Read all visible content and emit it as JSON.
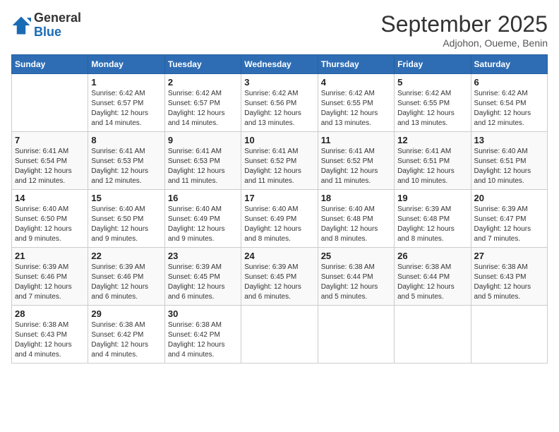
{
  "logo": {
    "line1": "General",
    "line2": "Blue"
  },
  "title": "September 2025",
  "subtitle": "Adjohon, Oueme, Benin",
  "days_header": [
    "Sunday",
    "Monday",
    "Tuesday",
    "Wednesday",
    "Thursday",
    "Friday",
    "Saturday"
  ],
  "weeks": [
    [
      {
        "num": "",
        "info": ""
      },
      {
        "num": "1",
        "info": "Sunrise: 6:42 AM\nSunset: 6:57 PM\nDaylight: 12 hours\nand 14 minutes."
      },
      {
        "num": "2",
        "info": "Sunrise: 6:42 AM\nSunset: 6:57 PM\nDaylight: 12 hours\nand 14 minutes."
      },
      {
        "num": "3",
        "info": "Sunrise: 6:42 AM\nSunset: 6:56 PM\nDaylight: 12 hours\nand 13 minutes."
      },
      {
        "num": "4",
        "info": "Sunrise: 6:42 AM\nSunset: 6:55 PM\nDaylight: 12 hours\nand 13 minutes."
      },
      {
        "num": "5",
        "info": "Sunrise: 6:42 AM\nSunset: 6:55 PM\nDaylight: 12 hours\nand 13 minutes."
      },
      {
        "num": "6",
        "info": "Sunrise: 6:42 AM\nSunset: 6:54 PM\nDaylight: 12 hours\nand 12 minutes."
      }
    ],
    [
      {
        "num": "7",
        "info": "Sunrise: 6:41 AM\nSunset: 6:54 PM\nDaylight: 12 hours\nand 12 minutes."
      },
      {
        "num": "8",
        "info": "Sunrise: 6:41 AM\nSunset: 6:53 PM\nDaylight: 12 hours\nand 12 minutes."
      },
      {
        "num": "9",
        "info": "Sunrise: 6:41 AM\nSunset: 6:53 PM\nDaylight: 12 hours\nand 11 minutes."
      },
      {
        "num": "10",
        "info": "Sunrise: 6:41 AM\nSunset: 6:52 PM\nDaylight: 12 hours\nand 11 minutes."
      },
      {
        "num": "11",
        "info": "Sunrise: 6:41 AM\nSunset: 6:52 PM\nDaylight: 12 hours\nand 11 minutes."
      },
      {
        "num": "12",
        "info": "Sunrise: 6:41 AM\nSunset: 6:51 PM\nDaylight: 12 hours\nand 10 minutes."
      },
      {
        "num": "13",
        "info": "Sunrise: 6:40 AM\nSunset: 6:51 PM\nDaylight: 12 hours\nand 10 minutes."
      }
    ],
    [
      {
        "num": "14",
        "info": "Sunrise: 6:40 AM\nSunset: 6:50 PM\nDaylight: 12 hours\nand 9 minutes."
      },
      {
        "num": "15",
        "info": "Sunrise: 6:40 AM\nSunset: 6:50 PM\nDaylight: 12 hours\nand 9 minutes."
      },
      {
        "num": "16",
        "info": "Sunrise: 6:40 AM\nSunset: 6:49 PM\nDaylight: 12 hours\nand 9 minutes."
      },
      {
        "num": "17",
        "info": "Sunrise: 6:40 AM\nSunset: 6:49 PM\nDaylight: 12 hours\nand 8 minutes."
      },
      {
        "num": "18",
        "info": "Sunrise: 6:40 AM\nSunset: 6:48 PM\nDaylight: 12 hours\nand 8 minutes."
      },
      {
        "num": "19",
        "info": "Sunrise: 6:39 AM\nSunset: 6:48 PM\nDaylight: 12 hours\nand 8 minutes."
      },
      {
        "num": "20",
        "info": "Sunrise: 6:39 AM\nSunset: 6:47 PM\nDaylight: 12 hours\nand 7 minutes."
      }
    ],
    [
      {
        "num": "21",
        "info": "Sunrise: 6:39 AM\nSunset: 6:46 PM\nDaylight: 12 hours\nand 7 minutes."
      },
      {
        "num": "22",
        "info": "Sunrise: 6:39 AM\nSunset: 6:46 PM\nDaylight: 12 hours\nand 6 minutes."
      },
      {
        "num": "23",
        "info": "Sunrise: 6:39 AM\nSunset: 6:45 PM\nDaylight: 12 hours\nand 6 minutes."
      },
      {
        "num": "24",
        "info": "Sunrise: 6:39 AM\nSunset: 6:45 PM\nDaylight: 12 hours\nand 6 minutes."
      },
      {
        "num": "25",
        "info": "Sunrise: 6:38 AM\nSunset: 6:44 PM\nDaylight: 12 hours\nand 5 minutes."
      },
      {
        "num": "26",
        "info": "Sunrise: 6:38 AM\nSunset: 6:44 PM\nDaylight: 12 hours\nand 5 minutes."
      },
      {
        "num": "27",
        "info": "Sunrise: 6:38 AM\nSunset: 6:43 PM\nDaylight: 12 hours\nand 5 minutes."
      }
    ],
    [
      {
        "num": "28",
        "info": "Sunrise: 6:38 AM\nSunset: 6:43 PM\nDaylight: 12 hours\nand 4 minutes."
      },
      {
        "num": "29",
        "info": "Sunrise: 6:38 AM\nSunset: 6:42 PM\nDaylight: 12 hours\nand 4 minutes."
      },
      {
        "num": "30",
        "info": "Sunrise: 6:38 AM\nSunset: 6:42 PM\nDaylight: 12 hours\nand 4 minutes."
      },
      {
        "num": "",
        "info": ""
      },
      {
        "num": "",
        "info": ""
      },
      {
        "num": "",
        "info": ""
      },
      {
        "num": "",
        "info": ""
      }
    ]
  ]
}
